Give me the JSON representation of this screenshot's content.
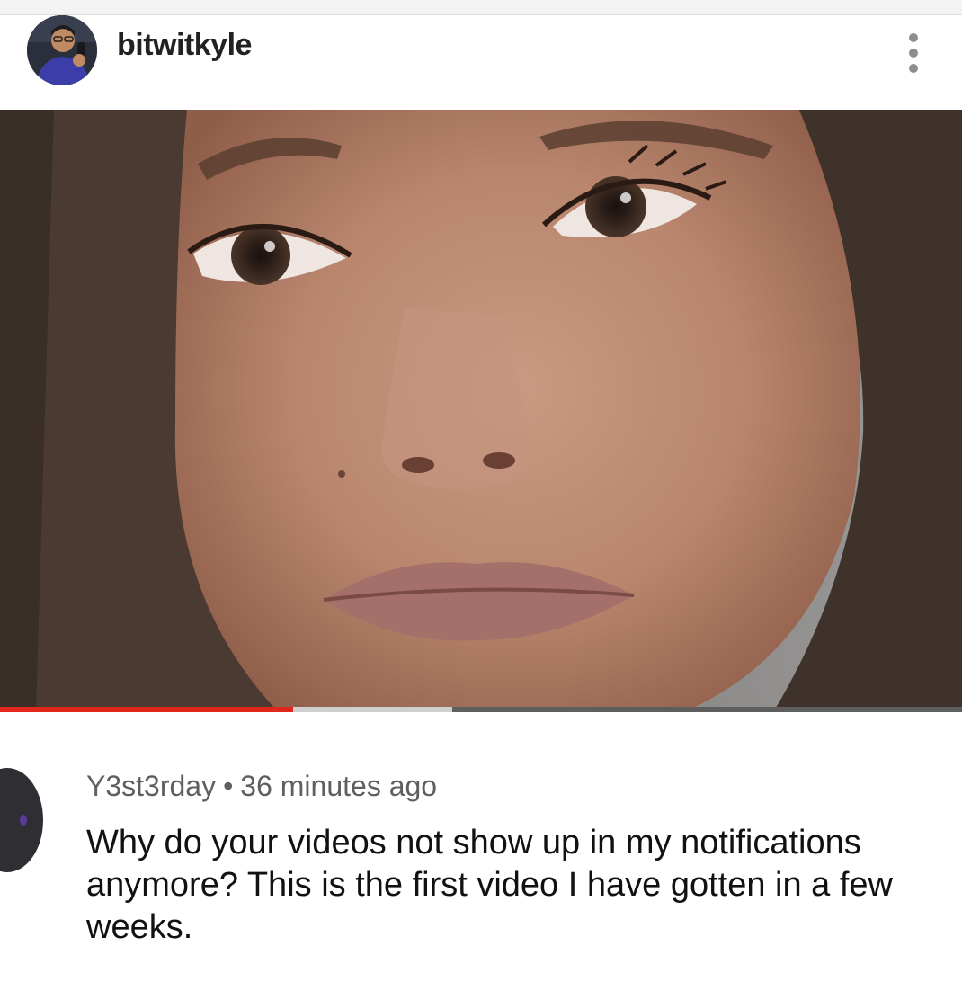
{
  "post": {
    "username": "bitwitkyle",
    "avatar_icon": "profile-photo",
    "more_icon": "vertical-ellipsis-icon"
  },
  "video": {
    "progress_played": 0.305,
    "progress_buffered": 0.47,
    "played_color": "#e1261c"
  },
  "comment": {
    "author": "Y3st3rday",
    "separator": "•",
    "timestamp": "36 minutes ago",
    "text": "Why do your videos not show up in my notifications anymore? This is the first video I have gotten in a few weeks."
  }
}
